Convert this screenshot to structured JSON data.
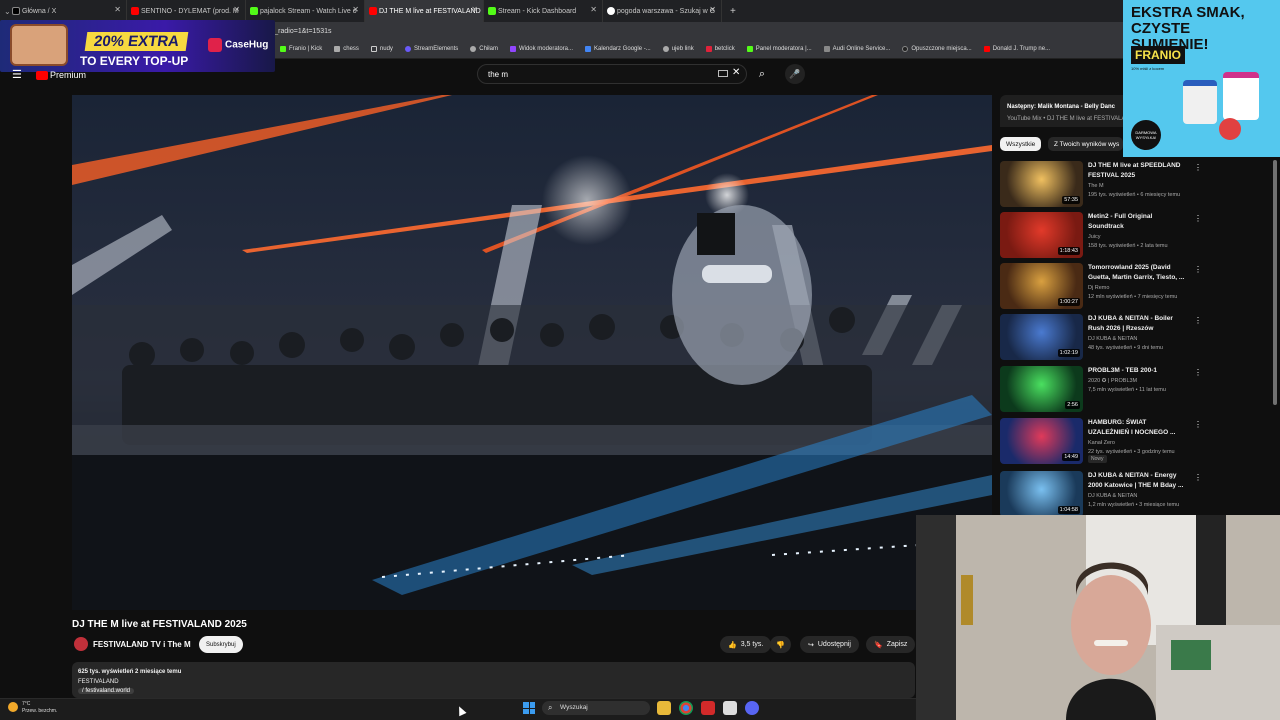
{
  "browser": {
    "tabs": [
      {
        "title": "Główna / X",
        "color": "#ffffff"
      },
      {
        "title": "SENTINO - DYLEMAT (prod. M",
        "color": "#ff0000"
      },
      {
        "title": "pajalock Stream - Watch Live o",
        "color": "#53fc18"
      },
      {
        "title": "DJ THE M live at FESTIVALAND",
        "color": "#ff0000",
        "active": true
      },
      {
        "title": "Stream - Kick Dashboard",
        "color": "#53fc18"
      },
      {
        "title": "pogoda warszawa - Szukaj w G",
        "color": "#4285f4"
      }
    ],
    "new_tab": "+",
    "url_fragment": "rt_radio=1&t=1531s",
    "bookmarks": [
      "Franio | Kick",
      "chess",
      "nudy",
      "StreamElements",
      "Chiłam",
      "Widok moderatora...",
      "Kalendarz Google -...",
      "ujeb link",
      "betclick",
      "Panel moderatora |...",
      "Audi Online Service...",
      "Opuszczone miejsca...",
      "Donald J. Trump ne..."
    ]
  },
  "ads": {
    "left": {
      "badge": "20% EXTRA",
      "line": "TO EVERY TOP-UP",
      "brand": "CaseHug"
    },
    "right": {
      "headline": "EKSTRA SMAK, CZYSTE SUMIENIE!",
      "brand": "FRANIO",
      "sub": "10% mlśli z kocem",
      "badge": "DARMOWA WYSYŁKA!"
    }
  },
  "youtube": {
    "logo": "Premium",
    "search": {
      "value": "the m"
    },
    "video": {
      "title": "DJ THE M live at FESTIVALAND 2025",
      "channel": "FESTIVALAND TV i The M",
      "subscribe": "Subskrybuj",
      "likes": "3,5 tys.",
      "share": "Udostępnij",
      "save": "Zapisz",
      "views_time": "625 tys. wyświetleń  2 miesiące temu",
      "desc_line": "FESTIVALAND",
      "link": "/ festivaland.world"
    },
    "queue": {
      "next": "Następny: Malik Montana - Belly Danc",
      "mix": "YouTube Mix • DJ THE M live at FESTIVALA"
    },
    "chips": [
      "Wszystkie",
      "Z Twoich wyników wys"
    ],
    "recommendations": [
      {
        "title": "DJ THE M live at SPEEDLAND FESTIVAL 2025",
        "channel": "The M",
        "meta": "195 tys. wyświetleń • 6 miesięcy temu",
        "duration": "57:35",
        "thumb": "#3a2a1a",
        "glow": "#f0c060"
      },
      {
        "title": "Metin2 - Full Original Soundtrack",
        "channel": "Juicy",
        "meta": "158 tys. wyświetleń • 2 lata temu",
        "duration": "1:18:43",
        "thumb": "#7a1a12",
        "glow": "#e23a2a"
      },
      {
        "title": "Tomorrowland 2025 (David Guetta, Martin Garrix, Tiesto, ...",
        "channel": "Dj Remo",
        "meta": "12 mln wyświetleń • 7 miesięcy temu",
        "duration": "1:00:27",
        "thumb": "#4a2a14",
        "glow": "#d9a040"
      },
      {
        "title": "DJ KUBA & NEITAN - Boiler Rush 2026 | Rzeszów",
        "channel": "DJ KUBA & NEITAN",
        "meta": "48 tys. wyświetleń • 9 dni temu",
        "duration": "1:02:19",
        "thumb": "#182848",
        "glow": "#4a7ad0"
      },
      {
        "title": "PROBL3M - TEB 200-1",
        "channel": "2020 ✪ | PROBL3M",
        "meta": "7,5 mln wyświetleń • 11 lat temu",
        "duration": "2:56",
        "thumb": "#0c3a1c",
        "glow": "#4ae060"
      },
      {
        "title": "HAMBURG: ŚWIAT UZALEŻNIEŃ I NOCNEGO ...",
        "channel": "Kanał Zero",
        "meta": "22 tys. wyświetleń • 3 godziny temu",
        "duration": "14:49",
        "thumb": "#1a2a6a",
        "glow": "#e03a5a",
        "badge": "Nowy"
      },
      {
        "title": "DJ KUBA & NEITAN - Energy 2000 Katowice | THE M Bday ...",
        "channel": "DJ KUBA & NEITAN",
        "meta": "1,2 mln wyświetleń • 3 miesiące temu",
        "duration": "1:04:58",
        "thumb": "#1a3a5a",
        "glow": "#7ac0f0"
      }
    ]
  },
  "taskbar": {
    "weather_temp": "7°C",
    "weather_desc": "Przew. bezchm.",
    "search": "Wyszukaj"
  },
  "colors": {
    "bg": "#0f0f0f",
    "accent_red": "#ff0000",
    "kick_green": "#53fc18"
  }
}
